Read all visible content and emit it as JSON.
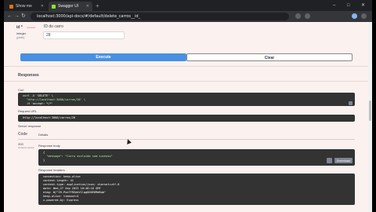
{
  "browser": {
    "tabs": [
      {
        "title": "Show me",
        "active": false,
        "favicon_color": "#e8710a"
      },
      {
        "title": "Swagger UI",
        "active": true,
        "favicon_color": "#85ea2d"
      }
    ],
    "new_tab": "+",
    "url": "localhost:3000/api-docs/#/default/delete_carros__id_",
    "window_controls": {
      "minimize": "–",
      "maximize": "□",
      "close": "✕"
    }
  },
  "params": {
    "id_required": "id *",
    "id_required_note": "required",
    "id_type": "integer",
    "id_location": "(path)",
    "id_description": "ID do carro",
    "id_value": "28"
  },
  "actions": {
    "execute_label": "Execute",
    "clear_label": "Clear"
  },
  "responses": {
    "heading": "Responses",
    "curl_label": "Curl",
    "curl_lines": [
      "curl -X 'DELETE' \\",
      "  'http://localhost:3000/carros/28' \\",
      "  -H 'accept: */*'"
    ],
    "request_url_label": "Request URL",
    "request_url": "http://localhost:3000/carros/28",
    "server_response_label": "Server response",
    "code_header": "Code",
    "details_header": "Details",
    "code_value": "200",
    "code_note": "Undocumented",
    "body_label": "Response body",
    "body_lines": [
      "{",
      "  \"message\": \"Carro excluído com sucesso\"",
      "}"
    ],
    "download_label": "Download",
    "headers_label": "Response headers",
    "header_lines": [
      "connection: keep-alive",
      "content-length: 41",
      "content-type: application/json; charset=utf-8",
      "date: Wed,27 Sep 2023 18:48:16 GMT",
      "etag: W/\"29-Pxe7YRSekV1lqgDO6E6MeBqb\"",
      "keep-alive: timeout=5",
      "x-powered-by: Express"
    ]
  }
}
